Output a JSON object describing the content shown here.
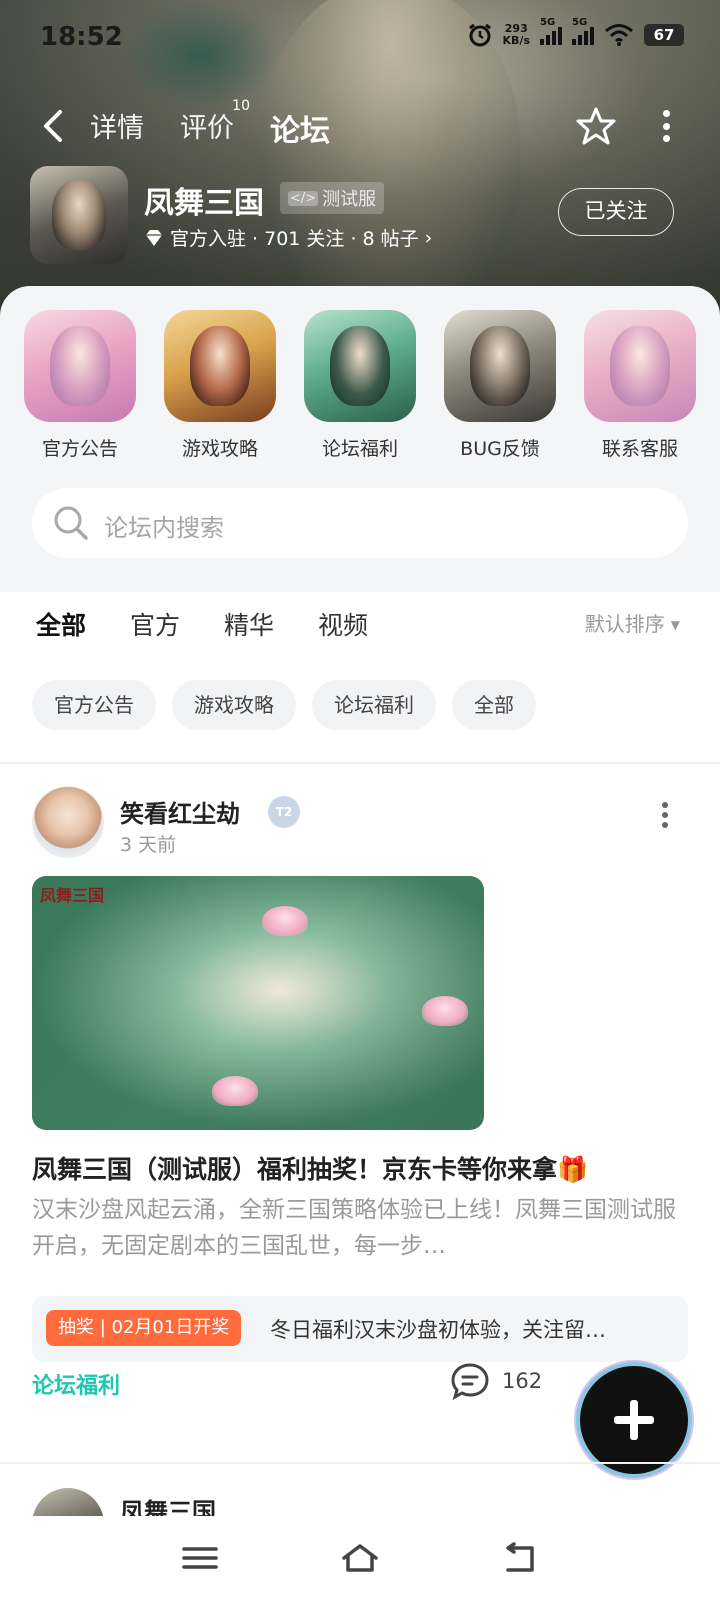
{
  "status_bar": {
    "time": "18:52",
    "speed_value": "293",
    "speed_unit": "KB/s",
    "sim1": "5G",
    "sim2": "5G",
    "battery": "67"
  },
  "nav": {
    "tabs": [
      {
        "label": "详情"
      },
      {
        "label": "评价",
        "badge": "10"
      },
      {
        "label": "论坛"
      }
    ],
    "active_tab": "论坛"
  },
  "game": {
    "name": "凤舞三国",
    "test_tag": "测试服",
    "meta": "官方入驻 · 701 关注 · 8 帖子",
    "follow_button": "已关注"
  },
  "shortcuts": [
    {
      "label": "官方公告"
    },
    {
      "label": "游戏攻略"
    },
    {
      "label": "论坛福利"
    },
    {
      "label": "BUG反馈"
    },
    {
      "label": "联系客服"
    }
  ],
  "search": {
    "placeholder": "论坛内搜索"
  },
  "categories": [
    "全部",
    "官方",
    "精华",
    "视频"
  ],
  "sort": {
    "label": "默认排序"
  },
  "chips": [
    "官方公告",
    "游戏攻略",
    "论坛福利",
    "全部"
  ],
  "post": {
    "author": "笑看红尘劫",
    "level": "2",
    "time": "3 天前",
    "image_watermark": "凤舞三国",
    "title": "凤舞三国（测试服）福利抽奖！京东卡等你来拿",
    "desc": "汉末沙盘风起云涌，全新三国策略体验已上线！凤舞三国测试服开启，无固定剧本的三国乱世，每一步…",
    "lottery_tag": "抽奖 | 02月01日开奖",
    "lottery_text": "冬日福利汉末沙盘初体验，关注留…",
    "forum_tag": "论坛福利",
    "comment_count": "162"
  },
  "next_post": {
    "author": "凤舞三国"
  },
  "colors": {
    "accent": "#1ed1b1",
    "lottery": "#ff6b3d",
    "tag": "#1ec7b0"
  }
}
